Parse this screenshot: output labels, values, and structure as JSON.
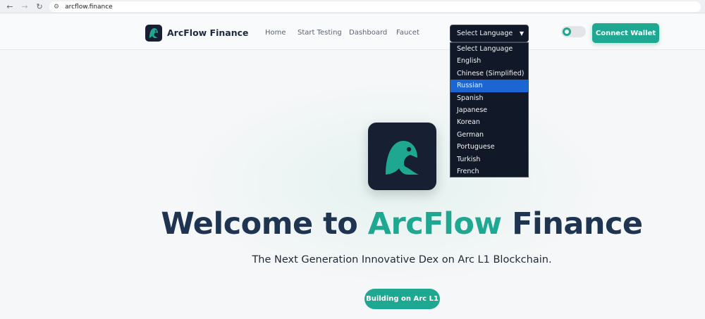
{
  "browser": {
    "url": "arcflow.finance",
    "back_icon": "arrow-left-icon",
    "forward_icon": "arrow-right-icon",
    "reload_icon": "reload-icon"
  },
  "header": {
    "brand": "ArcFlow Finance",
    "nav": [
      "Home",
      "Start Testing",
      "Dashboard",
      "Faucet"
    ],
    "language_select": {
      "value": "Select Language",
      "options": [
        "Select Language",
        "English",
        "Chinese (Simplified)",
        "Russian",
        "Spanish",
        "Japanese",
        "Korean",
        "German",
        "Portuguese",
        "Turkish",
        "French"
      ],
      "highlighted": "Russian"
    },
    "connect_label": "Connect Wallet"
  },
  "hero": {
    "title_part1": "Welcome to",
    "title_part2": "ArcFlow",
    "title_part3": "Finance",
    "subtitle": "The Next Generation Innovative Dex on Arc L1 Blockchain.",
    "button_label": "Building on Arc L1"
  },
  "colors": {
    "accent": "#1ea892",
    "dark": "#1e3450",
    "logo_bg": "#172033",
    "dropdown_bg": "#111827",
    "dropdown_highlight": "#1b66d2"
  }
}
